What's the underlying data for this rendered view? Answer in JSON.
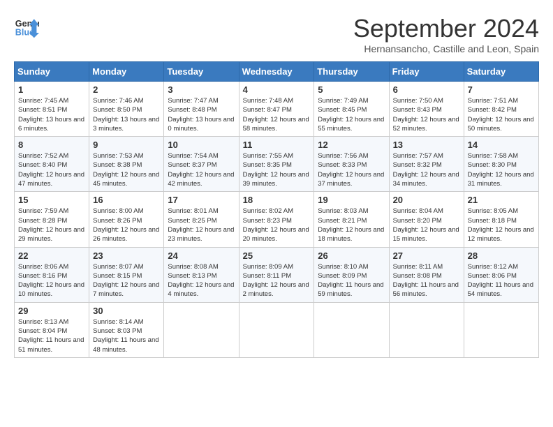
{
  "header": {
    "logo_line1": "General",
    "logo_line2": "Blue",
    "month_title": "September 2024",
    "subtitle": "Hernansancho, Castille and Leon, Spain"
  },
  "weekdays": [
    "Sunday",
    "Monday",
    "Tuesday",
    "Wednesday",
    "Thursday",
    "Friday",
    "Saturday"
  ],
  "weeks": [
    [
      {
        "day": "1",
        "sunrise": "7:45 AM",
        "sunset": "8:51 PM",
        "daylight": "13 hours and 6 minutes."
      },
      {
        "day": "2",
        "sunrise": "7:46 AM",
        "sunset": "8:50 PM",
        "daylight": "13 hours and 3 minutes."
      },
      {
        "day": "3",
        "sunrise": "7:47 AM",
        "sunset": "8:48 PM",
        "daylight": "13 hours and 0 minutes."
      },
      {
        "day": "4",
        "sunrise": "7:48 AM",
        "sunset": "8:47 PM",
        "daylight": "12 hours and 58 minutes."
      },
      {
        "day": "5",
        "sunrise": "7:49 AM",
        "sunset": "8:45 PM",
        "daylight": "12 hours and 55 minutes."
      },
      {
        "day": "6",
        "sunrise": "7:50 AM",
        "sunset": "8:43 PM",
        "daylight": "12 hours and 52 minutes."
      },
      {
        "day": "7",
        "sunrise": "7:51 AM",
        "sunset": "8:42 PM",
        "daylight": "12 hours and 50 minutes."
      }
    ],
    [
      {
        "day": "8",
        "sunrise": "7:52 AM",
        "sunset": "8:40 PM",
        "daylight": "12 hours and 47 minutes."
      },
      {
        "day": "9",
        "sunrise": "7:53 AM",
        "sunset": "8:38 PM",
        "daylight": "12 hours and 45 minutes."
      },
      {
        "day": "10",
        "sunrise": "7:54 AM",
        "sunset": "8:37 PM",
        "daylight": "12 hours and 42 minutes."
      },
      {
        "day": "11",
        "sunrise": "7:55 AM",
        "sunset": "8:35 PM",
        "daylight": "12 hours and 39 minutes."
      },
      {
        "day": "12",
        "sunrise": "7:56 AM",
        "sunset": "8:33 PM",
        "daylight": "12 hours and 37 minutes."
      },
      {
        "day": "13",
        "sunrise": "7:57 AM",
        "sunset": "8:32 PM",
        "daylight": "12 hours and 34 minutes."
      },
      {
        "day": "14",
        "sunrise": "7:58 AM",
        "sunset": "8:30 PM",
        "daylight": "12 hours and 31 minutes."
      }
    ],
    [
      {
        "day": "15",
        "sunrise": "7:59 AM",
        "sunset": "8:28 PM",
        "daylight": "12 hours and 29 minutes."
      },
      {
        "day": "16",
        "sunrise": "8:00 AM",
        "sunset": "8:26 PM",
        "daylight": "12 hours and 26 minutes."
      },
      {
        "day": "17",
        "sunrise": "8:01 AM",
        "sunset": "8:25 PM",
        "daylight": "12 hours and 23 minutes."
      },
      {
        "day": "18",
        "sunrise": "8:02 AM",
        "sunset": "8:23 PM",
        "daylight": "12 hours and 20 minutes."
      },
      {
        "day": "19",
        "sunrise": "8:03 AM",
        "sunset": "8:21 PM",
        "daylight": "12 hours and 18 minutes."
      },
      {
        "day": "20",
        "sunrise": "8:04 AM",
        "sunset": "8:20 PM",
        "daylight": "12 hours and 15 minutes."
      },
      {
        "day": "21",
        "sunrise": "8:05 AM",
        "sunset": "8:18 PM",
        "daylight": "12 hours and 12 minutes."
      }
    ],
    [
      {
        "day": "22",
        "sunrise": "8:06 AM",
        "sunset": "8:16 PM",
        "daylight": "12 hours and 10 minutes."
      },
      {
        "day": "23",
        "sunrise": "8:07 AM",
        "sunset": "8:15 PM",
        "daylight": "12 hours and 7 minutes."
      },
      {
        "day": "24",
        "sunrise": "8:08 AM",
        "sunset": "8:13 PM",
        "daylight": "12 hours and 4 minutes."
      },
      {
        "day": "25",
        "sunrise": "8:09 AM",
        "sunset": "8:11 PM",
        "daylight": "12 hours and 2 minutes."
      },
      {
        "day": "26",
        "sunrise": "8:10 AM",
        "sunset": "8:09 PM",
        "daylight": "11 hours and 59 minutes."
      },
      {
        "day": "27",
        "sunrise": "8:11 AM",
        "sunset": "8:08 PM",
        "daylight": "11 hours and 56 minutes."
      },
      {
        "day": "28",
        "sunrise": "8:12 AM",
        "sunset": "8:06 PM",
        "daylight": "11 hours and 54 minutes."
      }
    ],
    [
      {
        "day": "29",
        "sunrise": "8:13 AM",
        "sunset": "8:04 PM",
        "daylight": "11 hours and 51 minutes."
      },
      {
        "day": "30",
        "sunrise": "8:14 AM",
        "sunset": "8:03 PM",
        "daylight": "11 hours and 48 minutes."
      },
      null,
      null,
      null,
      null,
      null
    ]
  ]
}
